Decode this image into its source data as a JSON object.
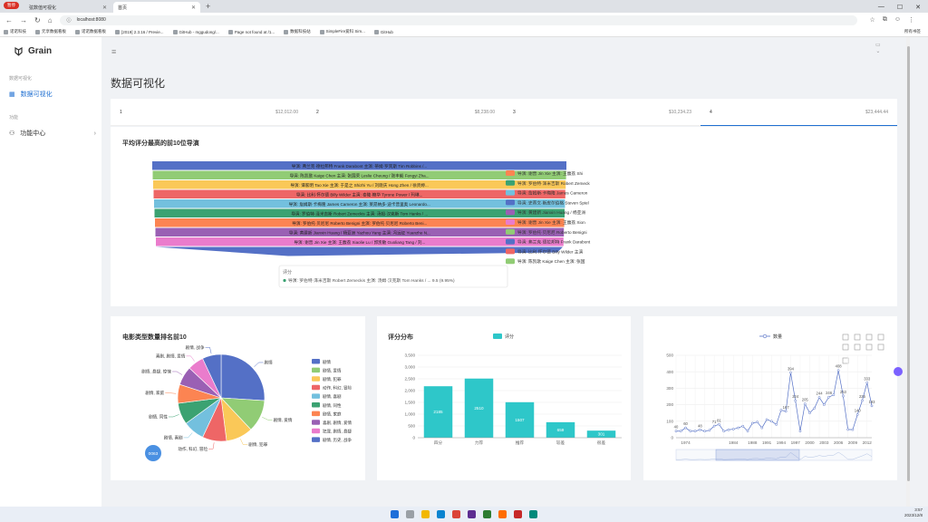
{
  "browser": {
    "badge": "暂停",
    "tabs": [
      {
        "title": "弦数值可视化",
        "active": false
      },
      {
        "title": "首页",
        "active": true
      }
    ],
    "url": "localhost:8080",
    "bookmarks": [
      "诺诺科技",
      "元享数据看板",
      "诺诺数据看板",
      "[2019] 2.3.16 / Previe...",
      "GitHub - mggudong/...",
      "Page not found at /1...",
      "数据科技站",
      "SimpleFire爱科 Sim...",
      "GitHub"
    ],
    "bookmarks_right": "所有书签"
  },
  "app": {
    "logo": "Grain",
    "sidebar": {
      "groups": [
        {
          "label": "数据可视化",
          "items": [
            {
              "label": "数据可视化",
              "active": true
            }
          ]
        },
        {
          "label": "功能",
          "items": [
            {
              "label": "功能中心",
              "active": false
            }
          ]
        }
      ]
    },
    "page_title": "数据可视化"
  },
  "stats": [
    {
      "label": "1",
      "value": "$12,012.00"
    },
    {
      "label": "2",
      "value": "$8,238.00"
    },
    {
      "label": "3",
      "value": "$10,234.23"
    },
    {
      "label": "4",
      "value": "$23,444.44"
    }
  ],
  "funnel": {
    "title": "平均评分最高的前10位导演",
    "rows": [
      {
        "text": "导演: 弗兰克·德拉邦特 Frank Darabont  主演: 蒂姆·罗宾斯 Tim Robbins /...",
        "color": "#5470c6"
      },
      {
        "text": "导演: 陈凯歌 Kaige Chen  主演: 张国荣 Leslie Cheung / 张丰毅 Fengyi Zha...",
        "color": "#91cc75"
      },
      {
        "text": "导演: 谭家明 Tao Xie  主演: 于是之 Shizhi Yu / 刘晓庆 Hong Zhen / 徐贤婷...",
        "color": "#fac858"
      },
      {
        "text": "导演: 比利·怀尔德 Billy Wilder  主演: 泰隆·鲍华 Tyrone Power / 玛琳...",
        "color": "#ee6666"
      },
      {
        "text": "导演: 詹姆斯·卡梅隆 James Cameron  主演: 莱昂纳多·迪卡普里奥 Leonardo...",
        "color": "#73c0de"
      },
      {
        "text": "导演: 罗伯特·泽米吉斯 Robert Zemeckis  主演: 汤姆·汉克斯 Tom Hanks / ...",
        "color": "#3ba272"
      },
      {
        "text": "导演: 罗伯托·贝尼尼 Roberto Benigni  主演: 罗伯托·贝尼尼 Roberto Beni...",
        "color": "#fc8452"
      },
      {
        "text": "导演: 黄建新 Jianxin Huang / 杨亚洲 Yazhou Yang  主演: 冯远征 Yuanzhe N...",
        "color": "#9a60b4"
      },
      {
        "text": "导演: 谢晋 Jin Xie  主演: 王馥荔 Xiaolie Lu / 郭凯敏 Guoliang Tang / 刘...",
        "color": "#ea7ccc"
      }
    ],
    "legend": [
      {
        "text": "导演: 谢晋 Jin Xie  主演: 王馥荔 Shi",
        "color": "#fc8452"
      },
      {
        "text": "导演: 罗伯特·泽米吉斯 Robert Zemeck",
        "color": "#3ba272"
      },
      {
        "text": "导演: 詹姆斯·卡梅隆 James Cameron",
        "color": "#73c0de"
      },
      {
        "text": "导演: 史蒂文·斯皮尔伯格 Steven Spiel",
        "color": "#5470c6"
      },
      {
        "text": "导演: 黄建新 Jianxin Huang / 杨亚洲",
        "color": "#9a60b4"
      },
      {
        "text": "导演: 谢晋 Jin Xie  主演: 王馥荔 Xion",
        "color": "#ea7ccc"
      },
      {
        "text": "导演: 罗伯托·贝尼尼 Roberto Benigni",
        "color": "#91cc75"
      },
      {
        "text": "导演: 弗兰克·德拉邦特 Frank Darabont",
        "color": "#5470c6"
      },
      {
        "text": "导演: 比利·怀尔德 Billy Wilder  主演",
        "color": "#ee6666"
      },
      {
        "text": "导演: 陈凯歌 Kaige Chen  主演: 张国",
        "color": "#91cc75"
      }
    ],
    "tooltip_title": "评分",
    "tooltip_text": "导演: 罗伯特·泽米吉斯 Robert Zemeckis  主演: 汤姆·汉克斯 Tom Hanks / ... 9.5 (9.95%)"
  },
  "pie": {
    "title": "电影类型数量排名前10",
    "slices": [
      {
        "name": "剧情",
        "value": 26,
        "color": "#5470c6"
      },
      {
        "name": "剧情, 爱情",
        "value": 12,
        "color": "#91cc75"
      },
      {
        "name": "剧情, 犯罪",
        "value": 10,
        "color": "#fac858"
      },
      {
        "name": "动作, 科幻, 冒险",
        "value": 9,
        "color": "#ee6666"
      },
      {
        "name": "剧情, 喜剧",
        "value": 8,
        "color": "#73c0de"
      },
      {
        "name": "剧情, 同性",
        "value": 8,
        "color": "#3ba272"
      },
      {
        "name": "剧情, 家庭",
        "value": 7,
        "color": "#fc8452"
      },
      {
        "name": "剧情, 悬疑, 惊悚",
        "value": 7,
        "color": "#9a60b4"
      },
      {
        "name": "喜剧, 剧情, 爱情",
        "value": 6,
        "color": "#ea7ccc"
      },
      {
        "name": "剧情, 战争",
        "value": 7,
        "color": "#5470c6"
      }
    ],
    "legend": [
      "剧情",
      "剧情, 爱情",
      "剧情, 犯罪",
      "动作, 科幻, 冒险",
      "剧情, 喜剧",
      "剧情, 同性",
      "剧情, 家庭",
      "喜剧, 剧情, 爱情",
      "犯罪, 剧情, 悬疑",
      "剧情, 历史, 战争"
    ],
    "badge": "0063"
  },
  "bar": {
    "title": "评分分布",
    "legend": "评分",
    "color": "#2ec7c9"
  },
  "line": {
    "legend": "数量",
    "color": "#5470c6"
  },
  "chart_data": [
    {
      "type": "bar",
      "title": "评分分布",
      "categories": [
        "四分",
        "力荐",
        "推荐",
        "较差",
        "很差"
      ],
      "values": [
        2185,
        2510,
        1507,
        659,
        301
      ],
      "ylim": [
        0,
        3500
      ],
      "yticks": [
        "0",
        "500",
        "1,000",
        "1,500",
        "2,000",
        "2,500",
        "3,000",
        "3,500"
      ]
    },
    {
      "type": "line",
      "series": [
        {
          "name": "数量",
          "x": [
            1972,
            1973,
            1974,
            1975,
            1976,
            1977,
            1978,
            1979,
            1980,
            1981,
            1982,
            1983,
            1984,
            1985,
            1986,
            1987,
            1988,
            1989,
            1990,
            1991,
            1992,
            1993,
            1994,
            1995,
            1996,
            1997,
            1998,
            1999,
            2000,
            2001,
            2002,
            2003,
            2004,
            2005,
            2006,
            2007,
            2008,
            2009,
            2010,
            2011,
            2012,
            2013
          ],
          "values": [
            40,
            40,
            60,
            40,
            40,
            48,
            40,
            45,
            71,
            81,
            40,
            48,
            52,
            60,
            70,
            40,
            88,
            95,
            60,
            110,
            100,
            80,
            167,
            160,
            394,
            224,
            40,
            205,
            150,
            180,
            244,
            200,
            246,
            260,
            408,
            253,
            50,
            49,
            140,
            225,
            333,
            193
          ]
        }
      ],
      "xticks": [
        "1974",
        "1984",
        "1988",
        "1991",
        "1994",
        "1997",
        "2000",
        "2003",
        "2006",
        "2009",
        "2012"
      ],
      "ylim": [
        0,
        500
      ],
      "yticks": [
        "0",
        "100",
        "200",
        "300",
        "400",
        "500"
      ],
      "labels": [
        {
          "x": 1972,
          "v": "40"
        },
        {
          "x": 1974,
          "v": "60"
        },
        {
          "x": 1977,
          "v": "48"
        },
        {
          "x": 1980,
          "v": "71"
        },
        {
          "x": 1981,
          "v": "81"
        },
        {
          "x": 1995,
          "v": "167"
        },
        {
          "x": 1996,
          "v": "394"
        },
        {
          "x": 1997,
          "v": "224"
        },
        {
          "x": 1999,
          "v": "205"
        },
        {
          "x": 2002,
          "v": "244"
        },
        {
          "x": 2004,
          "v": "246"
        },
        {
          "x": 2006,
          "v": "408"
        },
        {
          "x": 2007,
          "v": "253"
        },
        {
          "x": 2010,
          "v": "140"
        },
        {
          "x": 2011,
          "v": "225"
        },
        {
          "x": 2012,
          "v": "333"
        },
        {
          "x": 2013,
          "v": "193"
        }
      ]
    }
  ],
  "taskbar": {
    "time": "3:57",
    "date": "2023/12/8"
  }
}
